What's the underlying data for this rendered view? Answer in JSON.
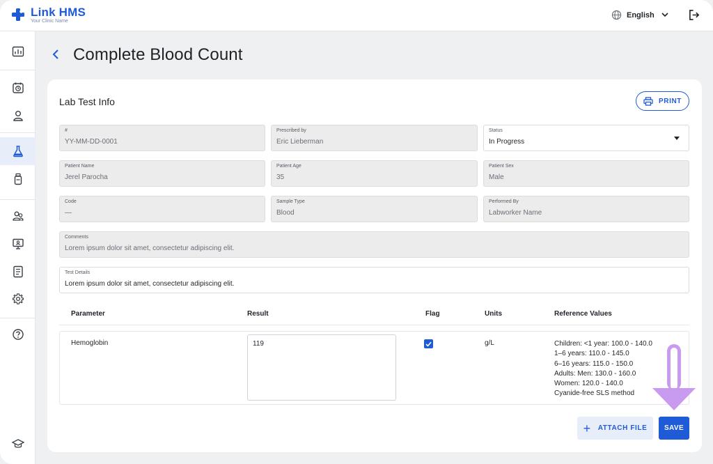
{
  "app": {
    "title": "Link HMS",
    "subtitle": "Your Clinic Name"
  },
  "topbar": {
    "language": "English"
  },
  "page": {
    "title": "Complete Blood Count"
  },
  "card": {
    "section_title": "Lab Test Info",
    "print_label": "PRINT"
  },
  "fields": {
    "id": {
      "label": "#",
      "value": "YY-MM-DD-0001"
    },
    "prescribed_by": {
      "label": "Prescribed by",
      "value": "Eric Lieberman"
    },
    "status": {
      "label": "Status",
      "value": "In Progress"
    },
    "patient_name": {
      "label": "Patient Name",
      "value": "Jerel Parocha"
    },
    "patient_age": {
      "label": "Patient Age",
      "value": "35"
    },
    "patient_sex": {
      "label": "Patient Sex",
      "value": "Male"
    },
    "code": {
      "label": "Code",
      "value": "—"
    },
    "sample_type": {
      "label": "Sample Type",
      "value": "Blood"
    },
    "performed_by": {
      "label": "Performed By",
      "value": "Labworker Name"
    },
    "comments": {
      "label": "Comments",
      "value": "Lorem ipsum dolor sit amet, consectetur adipiscing elit."
    },
    "test_details": {
      "label": "Test Details",
      "value": "Lorem ipsum dolor sit amet, consectetur adipiscing elit."
    }
  },
  "table": {
    "headers": {
      "parameter": "Parameter",
      "result": "Result",
      "flag": "Flag",
      "units": "Units",
      "reference": "Reference Values"
    },
    "rows": [
      {
        "parameter": "Hemoglobin",
        "result": "119",
        "flag_checked": true,
        "units": "g/L",
        "reference": [
          "Children: <1 year: 100.0 - 140.0",
          "1–6 years: 110.0 - 145.0",
          "6–16 years: 115.0 - 150.0",
          "Adults: Men: 130.0 - 160.0",
          "Women: 120.0 - 140.0",
          "Cyanide-free SLS method"
        ]
      }
    ]
  },
  "actions": {
    "attach_label": "ATTACH FILE",
    "save_label": "SAVE"
  },
  "colors": {
    "accent": "#1f5bd6",
    "highlight_arrow": "#c99bf0"
  },
  "icons": {
    "sidebar": [
      "dashboard-icon",
      "calendar-clock-icon",
      "person-icon",
      "lab-flask-icon",
      "bottle-icon",
      "users-icon",
      "monitor-icon",
      "document-icon",
      "gear-icon",
      "help-icon",
      "graduation-cap-icon"
    ]
  }
}
